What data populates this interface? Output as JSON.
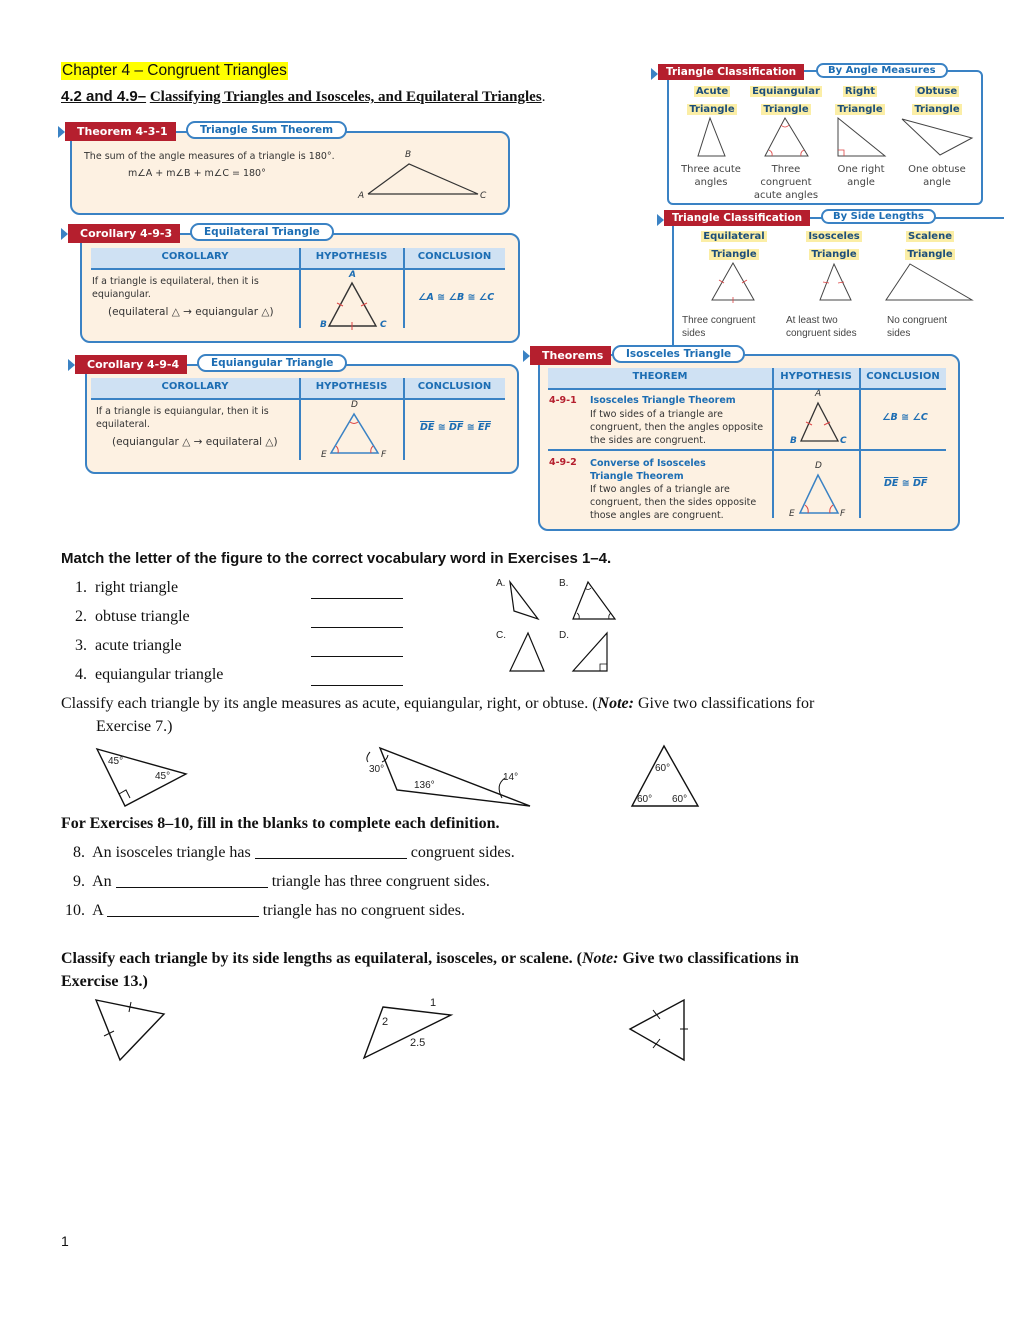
{
  "header": {
    "chapter_title": "Chapter 4 – Congruent Triangles",
    "section_number": "4.2 and 4.9–",
    "section_title": "Classifying Triangles and Isosceles, and Equilateral Triangles",
    "section_period": "."
  },
  "theorem_431": {
    "tab": "Theorem 4-3-1",
    "pill": "Triangle Sum Theorem",
    "statement": "The sum of the angle measures of a triangle is 180°.",
    "equation": "m∠A + m∠B + m∠C = 180°",
    "vertices": [
      "A",
      "B",
      "C"
    ]
  },
  "corollary_493": {
    "tab": "Corollary 4-9-3",
    "pill": "Equilateral Triangle",
    "headers": [
      "COROLLARY",
      "HYPOTHESIS",
      "CONCLUSION"
    ],
    "statement_line1": "If a triangle is equilateral, then it is",
    "statement_line2": "equiangular.",
    "symbolic": "(equilateral △ → equiangular △)",
    "vertices": [
      "A",
      "B",
      "C"
    ],
    "conclusion": "∠A ≅ ∠B ≅ ∠C"
  },
  "corollary_494": {
    "tab": "Corollary 4-9-4",
    "pill": "Equiangular Triangle",
    "headers": [
      "COROLLARY",
      "HYPOTHESIS",
      "CONCLUSION"
    ],
    "statement_line1": "If a triangle is equiangular, then it is",
    "statement_line2": "equilateral.",
    "symbolic": "(equiangular △ → equilateral △)",
    "vertices": [
      "D",
      "E",
      "F"
    ],
    "conclusion_parts": [
      "DE",
      "DF",
      "EF"
    ],
    "congruent_symbol": "≅"
  },
  "classification_angles": {
    "tab": "Triangle Classification",
    "pill": "By Angle Measures",
    "items": [
      {
        "title1": "Acute",
        "title2": "Triangle",
        "caption": [
          "Three acute",
          "angles"
        ]
      },
      {
        "title1": "Equiangular",
        "title2": "Triangle",
        "caption": [
          "Three",
          "congruent",
          "acute angles"
        ]
      },
      {
        "title1": "Right",
        "title2": "Triangle",
        "caption": [
          "One right",
          "angle"
        ]
      },
      {
        "title1": "Obtuse",
        "title2": "Triangle",
        "caption": [
          "One obtuse",
          "angle"
        ]
      }
    ]
  },
  "classification_sides": {
    "tab": "Triangle Classification",
    "pill": "By Side Lengths",
    "items": [
      {
        "title1": "Equilateral",
        "title2": "Triangle",
        "caption": [
          "Three congruent",
          "sides"
        ]
      },
      {
        "title1": "Isosceles",
        "title2": "Triangle",
        "caption": [
          "At least two",
          "congruent sides"
        ]
      },
      {
        "title1": "Scalene",
        "title2": "Triangle",
        "caption": [
          "No congruent",
          "sides"
        ]
      }
    ]
  },
  "isosceles_theorems": {
    "tab": "Theorems",
    "pill": "Isosceles Triangle",
    "headers": [
      "THEOREM",
      "HYPOTHESIS",
      "CONCLUSION"
    ],
    "rows": [
      {
        "number": "4-9-1",
        "name": [
          "Isosceles Triangle Theorem"
        ],
        "text": [
          "If two sides of a triangle are",
          "congruent, then the angles opposite",
          "the sides are congruent."
        ],
        "vertices": [
          "A",
          "B",
          "C"
        ],
        "conclusion": "∠B ≅ ∠C"
      },
      {
        "number": "4-9-2",
        "name": [
          "Converse of Isosceles",
          "Triangle Theorem"
        ],
        "text": [
          "If two angles of a triangle are",
          "congruent, then the sides opposite",
          "those angles are congruent."
        ],
        "vertices": [
          "D",
          "E",
          "F"
        ],
        "conclusion_parts": [
          "DE",
          "DF"
        ],
        "congruent_symbol": "≅"
      }
    ]
  },
  "exercises_match": {
    "heading": "Match the letter of the figure to the correct vocabulary word in Exercises 1–4.",
    "items": [
      {
        "num": "1.",
        "term": "right triangle",
        "answer": ""
      },
      {
        "num": "2.",
        "term": "obtuse triangle",
        "answer": ""
      },
      {
        "num": "3.",
        "term": "acute triangle",
        "answer": ""
      },
      {
        "num": "4.",
        "term": "equiangular triangle",
        "answer": ""
      }
    ],
    "figure_labels": [
      "A.",
      "B.",
      "C.",
      "D."
    ]
  },
  "exercises_angles": {
    "instruction_start": "Classify each triangle by its angle measures as acute, equiangular, right, or obtuse. (",
    "note_label": "Note:",
    "instruction_end": " Give two classifications for",
    "instruction_line2": "Exercise 7.)",
    "figures": [
      {
        "angles": [
          "45°",
          "45°"
        ]
      },
      {
        "angles": [
          "30°",
          "136°",
          "14°"
        ]
      },
      {
        "angles": [
          "60°",
          "60°",
          "60°"
        ]
      }
    ]
  },
  "exercises_fill": {
    "heading": "For Exercises 8–10, fill in the blanks to complete each definition.",
    "items": [
      {
        "num": "8.",
        "before": "An isosceles triangle has",
        "after": "congruent sides.",
        "answer": ""
      },
      {
        "num": "9.",
        "before": "An",
        "after": "triangle has three congruent sides.",
        "answer": ""
      },
      {
        "num": "10.",
        "before": "A",
        "after": "triangle has no congruent sides.",
        "answer": ""
      }
    ]
  },
  "exercises_sides": {
    "instruction_start": "Classify each triangle by its side lengths as equilateral, isosceles, or scalene. (",
    "note_label": "Note:",
    "instruction_end": " Give two classifications in",
    "instruction_line2": "Exercise 13.)",
    "figures": [
      {
        "side_labels": []
      },
      {
        "side_labels": [
          "1",
          "2",
          "2.5"
        ]
      },
      {
        "side_labels": []
      }
    ]
  },
  "footer": {
    "page_number": "1"
  },
  "colors": {
    "highlight": "#ffff00",
    "tab_red": "#b51f2e",
    "box_blue": "#3a82c4",
    "box_fill": "#fdf1e2",
    "accent_blue": "#1c6db3"
  }
}
